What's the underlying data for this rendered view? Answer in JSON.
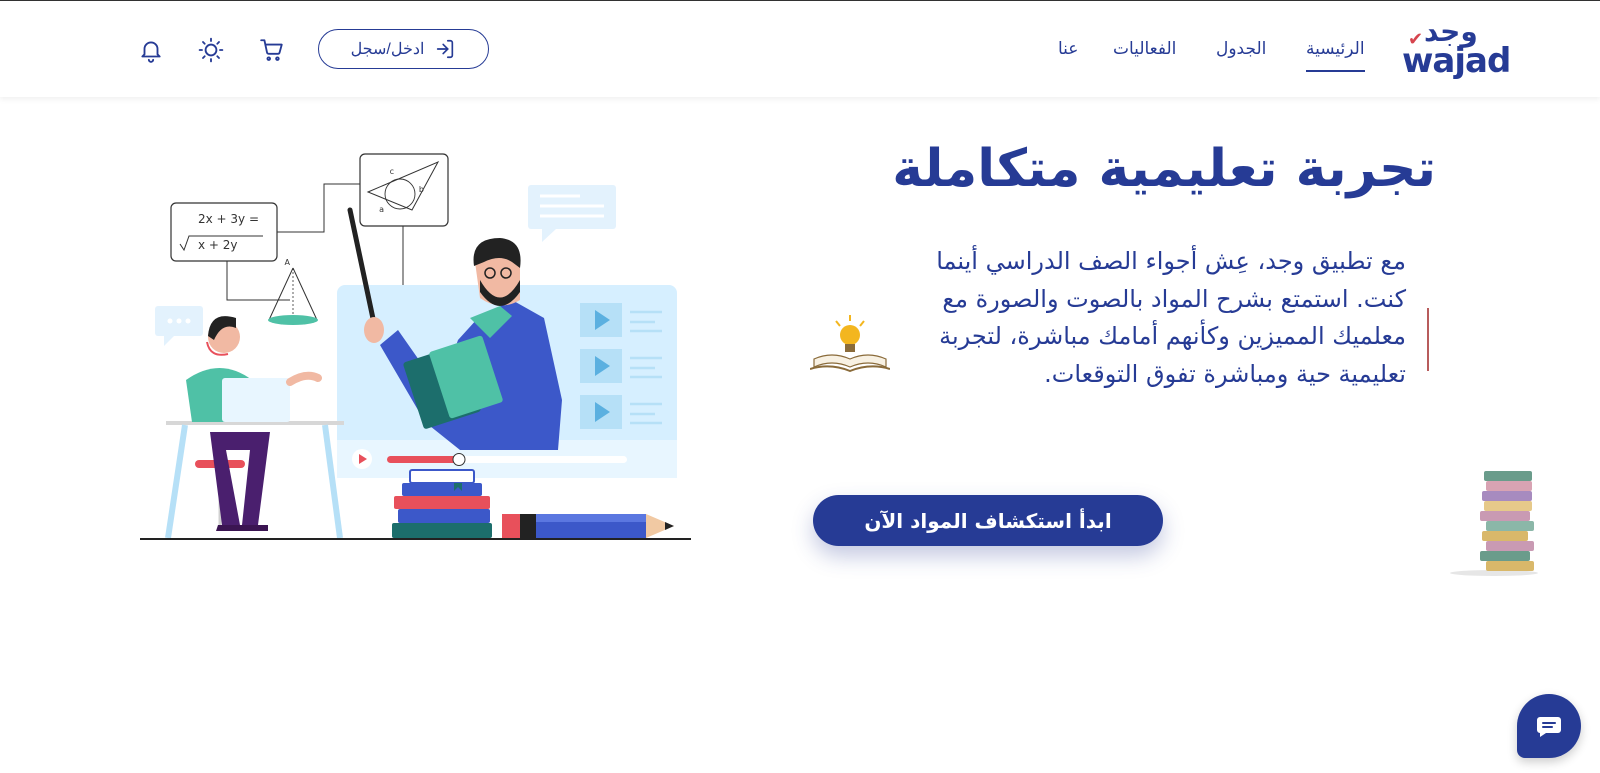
{
  "brand": {
    "logo_arabic": "وجد",
    "logo_latin": "wajad"
  },
  "nav": {
    "items": [
      {
        "label": "الرئيسية",
        "active": true
      },
      {
        "label": "الجدول",
        "active": false
      },
      {
        "label": "الفعاليات",
        "active": false
      },
      {
        "label": "عنا",
        "active": false
      }
    ]
  },
  "header_actions": {
    "login_label": "ادخل/سجل",
    "icons": [
      "login-icon",
      "cart-icon",
      "sun-icon",
      "bell-icon"
    ]
  },
  "hero": {
    "title": "تجربة تعليمية متكاملة",
    "description": "مع تطبيق وجد، عِش أجواء الصف الدراسي أينما كنت. استمتع بشرح المواد بالصوت والصورة مع معلميك المميزين وكأنهم أمامك مباشرة، لتجربة تعليمية حية ومباشرة تفوق التوقعات.",
    "cta_label": "ابدأ استكشاف المواد الآن"
  },
  "illustration": {
    "equation_line1": "2x + 3y =",
    "equation_line2": "x + 2y",
    "triangle_labels": [
      "c",
      "b",
      "a"
    ],
    "cone_label": "A",
    "video_progress": 0.3
  },
  "chat": {
    "icon": "chat-icon"
  },
  "colors": {
    "primary": "#263b95",
    "accent_red": "#e8505b",
    "teal": "#4fc1a6",
    "light_blue": "#d6efff"
  }
}
